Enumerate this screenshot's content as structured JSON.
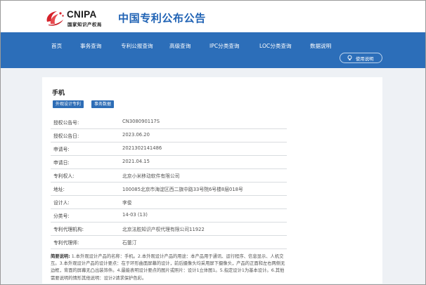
{
  "header": {
    "logo_en": "CNIPA",
    "logo_cn": "国家知识产权局",
    "site_title": "中国专利公布公告"
  },
  "nav": {
    "items": [
      "首页",
      "事务查询",
      "专利公报查询",
      "高级查询",
      "IPC分类查询",
      "LOC分类查询",
      "数据说明"
    ],
    "help_label": "使用说明"
  },
  "record": {
    "title": "手机",
    "tags": [
      "外观设计专利",
      "事务数据"
    ],
    "fields": [
      {
        "label": "授权公告号:",
        "value": "CN308090117S"
      },
      {
        "label": "授权公告日:",
        "value": "2023.06.20"
      },
      {
        "label": "申请号:",
        "value": "2021302141486"
      },
      {
        "label": "申请日:",
        "value": "2021.04.15"
      },
      {
        "label": "专利权人:",
        "value": "北京小米移动软件有限公司"
      },
      {
        "label": "地址:",
        "value": "100085北京市海淀区西二旗中路33号院6号楼8层018号"
      },
      {
        "label": "设计人:",
        "value": "李俊"
      },
      {
        "label": "分类号:",
        "value": "14-03 (13)"
      },
      {
        "label": "专利代理机构:",
        "value": "北京法胜知识产权代理有限公司11922"
      },
      {
        "label": "专利代理师:",
        "value": "石蕾汀"
      }
    ],
    "abstract_label": "简要说明:",
    "abstract_text": "1.本外观设计产品的名称：手机。2.本外观设计产品的用途：本产品用于通讯、运行程序、信息显示、人机交互。3.本外观设计产品的设计要点：在于环形曲面屏幕的设计，前后摄像头均采用屏下摄像头，产品的正面和左右两侧无边框，背面的屏幕无凸出装饰件。4.最能表明设计要点的图片或照片：设计1立体图1。5.指定设计1为基本设计。6.其他需要说明的情形其他说明：设计2请求保护色彩。"
  },
  "colors": {
    "brand_blue": "#2c6eb9",
    "title_blue": "#1f62b4",
    "content_bg": "#eef1f5"
  }
}
